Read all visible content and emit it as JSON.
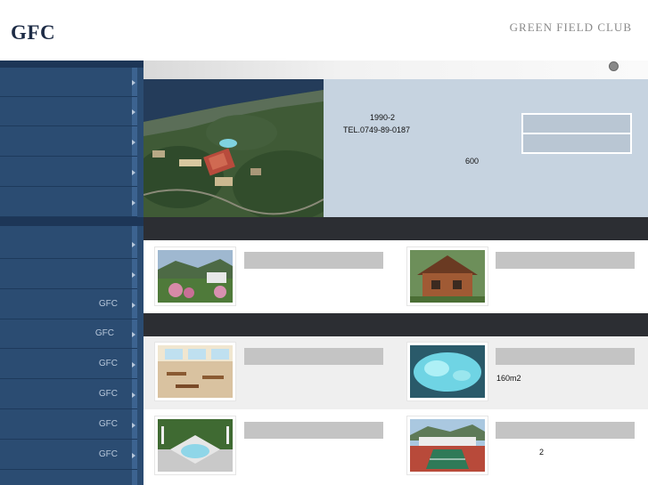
{
  "header": {
    "logo": "GFC",
    "brand": "GREEN FIELD CLUB"
  },
  "sidebar": {
    "items": [
      {
        "label": ""
      },
      {
        "label": ""
      },
      {
        "label": ""
      },
      {
        "label": ""
      },
      {
        "label": ""
      }
    ],
    "items2": [
      {
        "label": ""
      },
      {
        "label": ""
      },
      {
        "label": "GFC"
      },
      {
        "label": "GFC"
      },
      {
        "label": "GFC"
      },
      {
        "label": "GFC"
      },
      {
        "label": "GFC"
      },
      {
        "label": "GFC"
      }
    ]
  },
  "info": {
    "year": "1990-2",
    "tel": "TEL.0749-89-0187",
    "number": "600"
  },
  "facilities": {
    "pool_size": "160m2",
    "tennis_count": "2"
  },
  "colors": {
    "sidebar": "#2b4c72",
    "info_bg": "#c6d3e0",
    "band": "#2c2e33"
  }
}
